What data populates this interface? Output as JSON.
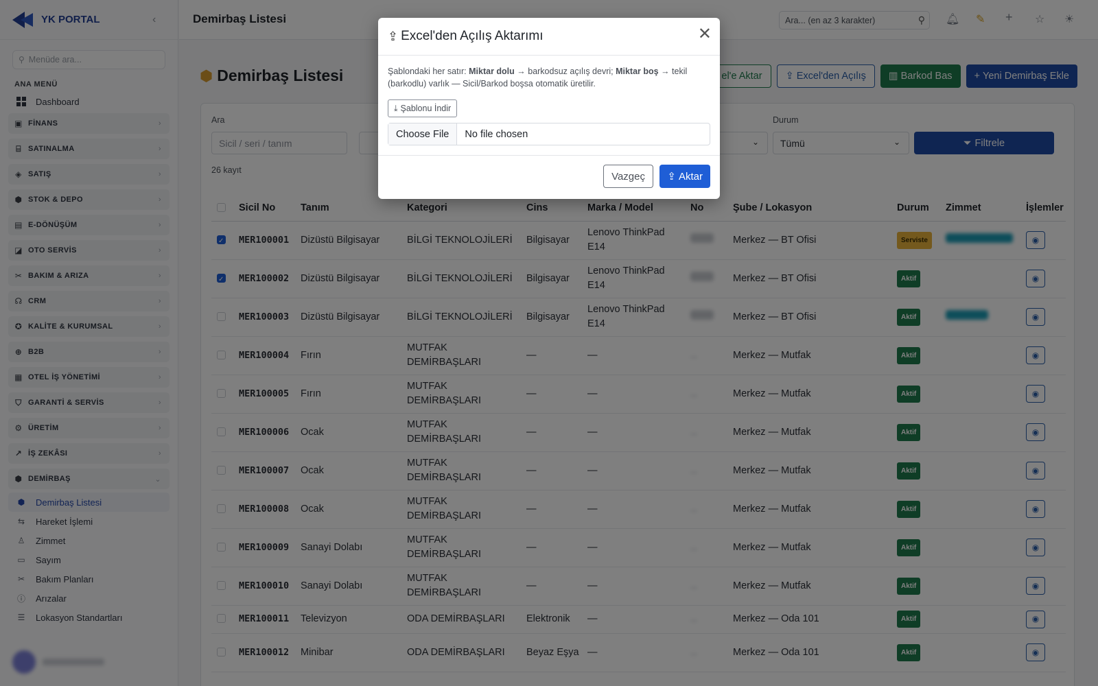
{
  "brand": "YK PORTAL",
  "sidebar": {
    "search_placeholder": "Menüde ara...",
    "section": "ANA MENÜ",
    "dashboard": "Dashboard",
    "groups": [
      {
        "label": "FİNANS",
        "icon": "finance-icon"
      },
      {
        "label": "SATINALMA",
        "icon": "cart-icon"
      },
      {
        "label": "SATIŞ",
        "icon": "tag-icon"
      },
      {
        "label": "STOK & DEPO",
        "icon": "box-icon"
      },
      {
        "label": "E-DÖNÜŞÜM",
        "icon": "document-icon"
      },
      {
        "label": "OTO SERVİS",
        "icon": "car-icon"
      },
      {
        "label": "BAKIM & ARIZA",
        "icon": "tools-icon"
      },
      {
        "label": "CRM",
        "icon": "headset-icon"
      },
      {
        "label": "KALİTE & KURUMSAL",
        "icon": "badge-icon"
      },
      {
        "label": "B2B",
        "icon": "globe-icon"
      },
      {
        "label": "OTEL İŞ YÖNETİMİ",
        "icon": "building-icon"
      },
      {
        "label": "GARANTİ & SERVİS",
        "icon": "shield-icon"
      },
      {
        "label": "ÜRETİM",
        "icon": "gear-icon"
      },
      {
        "label": "İŞ ZEKÂSI",
        "icon": "chart-icon"
      },
      {
        "label": "DEMİRBAŞ",
        "icon": "box-icon"
      }
    ],
    "subs": [
      "Demirbaş Listesi",
      "Hareket İşlemi",
      "Zimmet",
      "Sayım",
      "Bakım Planları",
      "Arızalar",
      "Lokasyon Standartları"
    ]
  },
  "topbar": {
    "title": "Demirbaş Listesi",
    "search": "Ara... (en az 3 karakter)"
  },
  "page": {
    "title": "Demirbaş Listesi",
    "buttons": {
      "excel_out": "el'e Aktar",
      "excel_open": "Excel'den Açılış",
      "barcode": "Barkod Bas",
      "new": "Yeni Demirbaş Ekle"
    },
    "filters": {
      "search_label": "Ara",
      "search_placeholder": "Sicil / seri / tanım",
      "status_label": "Durum",
      "status_value": "Tümü",
      "filter_btn": "Filtrele"
    },
    "count": "26 kayıt",
    "columns": [
      "Sicil No",
      "Tanım",
      "Kategori",
      "Cins",
      "Marka / Model",
      "No",
      "Şube / Lokasyon",
      "Durum",
      "Zimmet",
      "İşlemler"
    ],
    "rows": [
      {
        "sicil": "MER100001",
        "tanim": "Dizüstü Bilgisayar",
        "kat": "BİLGİ TEKNOLOJİLERİ",
        "cins": "Bilgisayar",
        "marka": "Lenovo ThinkPad E14",
        "lok": "Merkez — BT Ofisi",
        "durum": "Serviste",
        "checked": true
      },
      {
        "sicil": "MER100002",
        "tanim": "Dizüstü Bilgisayar",
        "kat": "BİLGİ TEKNOLOJİLERİ",
        "cins": "Bilgisayar",
        "marka": "Lenovo ThinkPad E14",
        "lok": "Merkez — BT Ofisi",
        "durum": "Aktif",
        "checked": true
      },
      {
        "sicil": "MER100003",
        "tanim": "Dizüstü Bilgisayar",
        "kat": "BİLGİ TEKNOLOJİLERİ",
        "cins": "Bilgisayar",
        "marka": "Lenovo ThinkPad E14",
        "lok": "Merkez — BT Ofisi",
        "durum": "Aktif",
        "checked": false
      },
      {
        "sicil": "MER100004",
        "tanim": "Fırın",
        "kat": "MUTFAK DEMİRBAŞLARI",
        "cins": "—",
        "marka": "—",
        "lok": "Merkez — Mutfak",
        "durum": "Aktif",
        "checked": false
      },
      {
        "sicil": "MER100005",
        "tanim": "Fırın",
        "kat": "MUTFAK DEMİRBAŞLARI",
        "cins": "—",
        "marka": "—",
        "lok": "Merkez — Mutfak",
        "durum": "Aktif",
        "checked": false
      },
      {
        "sicil": "MER100006",
        "tanim": "Ocak",
        "kat": "MUTFAK DEMİRBAŞLARI",
        "cins": "—",
        "marka": "—",
        "lok": "Merkez — Mutfak",
        "durum": "Aktif",
        "checked": false
      },
      {
        "sicil": "MER100007",
        "tanim": "Ocak",
        "kat": "MUTFAK DEMİRBAŞLARI",
        "cins": "—",
        "marka": "—",
        "lok": "Merkez — Mutfak",
        "durum": "Aktif",
        "checked": false
      },
      {
        "sicil": "MER100008",
        "tanim": "Ocak",
        "kat": "MUTFAK DEMİRBAŞLARI",
        "cins": "—",
        "marka": "—",
        "lok": "Merkez — Mutfak",
        "durum": "Aktif",
        "checked": false
      },
      {
        "sicil": "MER100009",
        "tanim": "Sanayi Dolabı",
        "kat": "MUTFAK DEMİRBAŞLARI",
        "cins": "—",
        "marka": "—",
        "lok": "Merkez — Mutfak",
        "durum": "Aktif",
        "checked": false
      },
      {
        "sicil": "MER100010",
        "tanim": "Sanayi Dolabı",
        "kat": "MUTFAK DEMİRBAŞLARI",
        "cins": "—",
        "marka": "—",
        "lok": "Merkez — Mutfak",
        "durum": "Aktif",
        "checked": false
      },
      {
        "sicil": "MER100011",
        "tanim": "Televizyon",
        "kat": "ODA DEMİRBAŞLARI",
        "cins": "Elektronik",
        "marka": "—",
        "lok": "Merkez — Oda 101",
        "durum": "Aktif",
        "checked": false
      },
      {
        "sicil": "MER100012",
        "tanim": "Minibar",
        "kat": "ODA DEMİRBAŞLARI",
        "cins": "Beyaz Eşya",
        "marka": "—",
        "lok": "Merkez — Oda 101",
        "durum": "Aktif",
        "checked": false
      }
    ]
  },
  "modal": {
    "title": "Excel'den Açılış Aktarımı",
    "desc_1": "Şablondaki her satır: ",
    "desc_b1": "Miktar dolu",
    "desc_2": " → barkodsuz açılış devri; ",
    "desc_b2": "Miktar boş",
    "desc_3": " → tekil (barkodlu) varlık — Sicil/Barkod boşsa otomatik üretilir.",
    "download": "Şablonu İndir",
    "choose": "Choose File",
    "nofile": "No file chosen",
    "cancel": "Vazgeç",
    "submit": "Aktar"
  }
}
